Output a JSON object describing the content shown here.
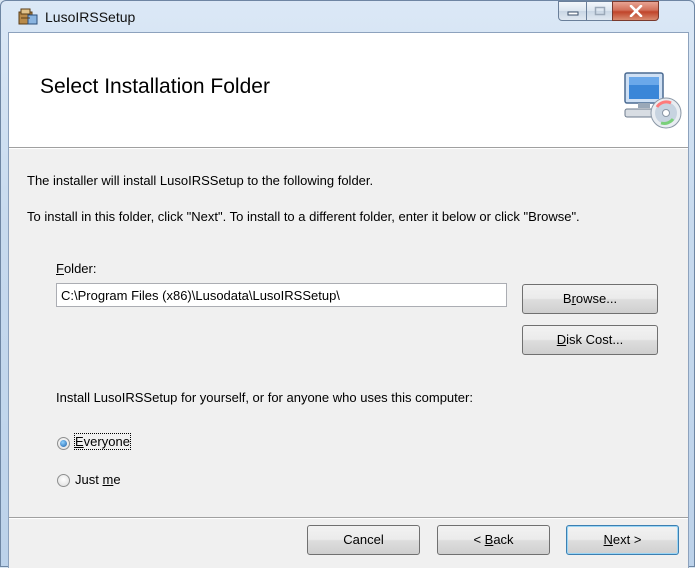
{
  "window": {
    "title": "LusoIRSSetup"
  },
  "header": {
    "title": "Select Installation Folder",
    "icon": "computer-cd-icon"
  },
  "body": {
    "intro": "The installer will install LusoIRSSetup to the following folder.",
    "instructions": "To install in this folder, click \"Next\". To install to a different folder, enter it below or click \"Browse\".",
    "folder_label_mnemonic": "F",
    "folder_label_rest": "older:",
    "folder_value": "C:\\Program Files (x86)\\Lusodata\\LusoIRSSetup\\",
    "browse": {
      "pre": "B",
      "mn": "r",
      "post": "owse..."
    },
    "disk_cost": {
      "pre": "",
      "mn": "D",
      "post": "isk Cost..."
    },
    "install_for": "Install LusoIRSSetup for yourself, or for anyone who uses this computer:",
    "options": {
      "everyone": {
        "pre": "",
        "mn": "E",
        "post": "veryone",
        "checked": true
      },
      "just_me": {
        "pre": "Just ",
        "mn": "m",
        "post": "e",
        "checked": false
      }
    }
  },
  "footer": {
    "cancel": "Cancel",
    "back": {
      "pre": "< ",
      "mn": "B",
      "post": "ack"
    },
    "next": {
      "pre": "",
      "mn": "N",
      "post": "ext >"
    }
  }
}
